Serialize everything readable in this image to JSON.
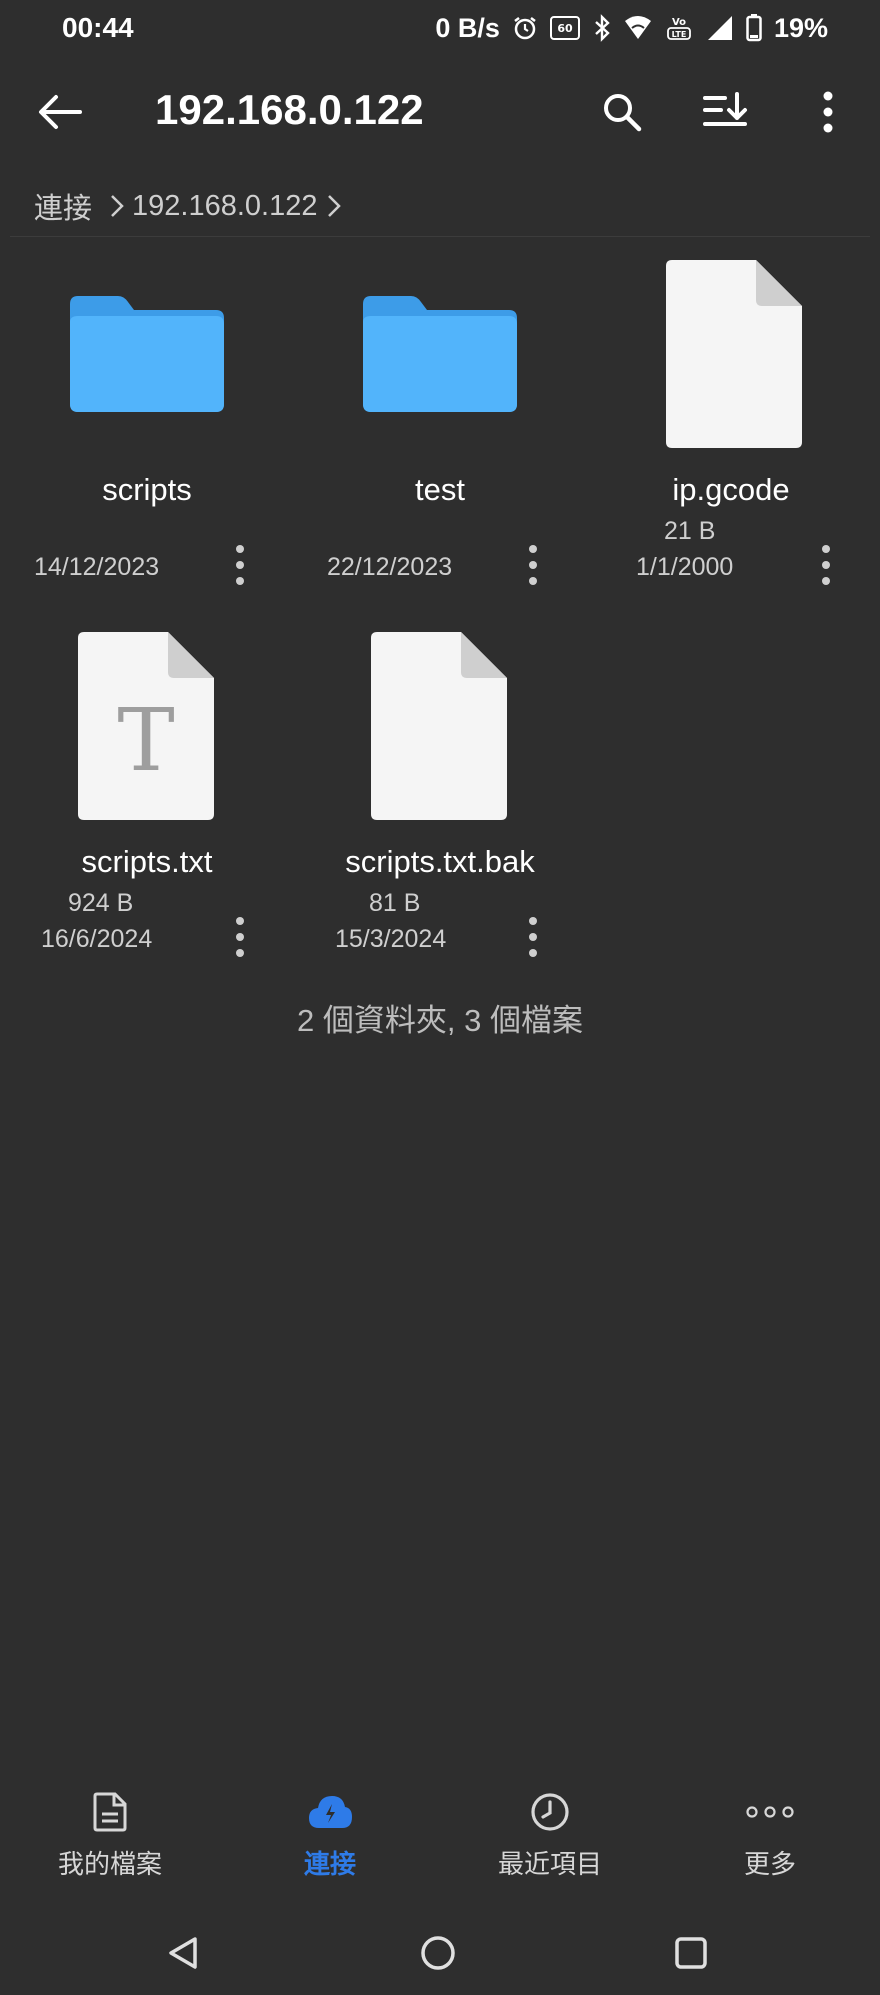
{
  "status_bar": {
    "time": "00:44",
    "net_speed": "0 B/s",
    "battery": "19%",
    "icons": [
      "alarm-icon",
      "60hz-icon",
      "bluetooth-icon",
      "wifi-icon",
      "volte-icon",
      "signal-icon",
      "battery-icon"
    ]
  },
  "app_bar": {
    "title": "192.168.0.122",
    "icons": [
      "back-arrow-icon",
      "search-icon",
      "sort-icon",
      "more-vert-icon"
    ]
  },
  "breadcrumb": [
    "連接",
    "192.168.0.122"
  ],
  "items": [
    {
      "name": "scripts",
      "type": "folder",
      "size": "",
      "date": "14/12/2023"
    },
    {
      "name": "test",
      "type": "folder",
      "size": "",
      "date": "22/12/2023"
    },
    {
      "name": "ip.gcode",
      "type": "file",
      "size": "21 B",
      "date": "1/1/2000"
    },
    {
      "name": "scripts.txt",
      "type": "text-file",
      "size": "924 B",
      "date": "16/6/2024"
    },
    {
      "name": "scripts.txt.bak",
      "type": "file",
      "size": "81 B",
      "date": "15/3/2024"
    }
  ],
  "summary": "2 個資料夾, 3 個檔案",
  "bottom_nav": [
    {
      "label": "我的檔案",
      "icon": "file-icon",
      "active": false
    },
    {
      "label": "連接",
      "icon": "cloud-icon",
      "active": true
    },
    {
      "label": "最近項目",
      "icon": "clock-icon",
      "active": false
    },
    {
      "label": "更多",
      "icon": "more-horiz-icon",
      "active": false
    }
  ],
  "colors": {
    "background": "#2e2e2e",
    "accent": "#2e7be8",
    "folder": "#42a8f5"
  }
}
